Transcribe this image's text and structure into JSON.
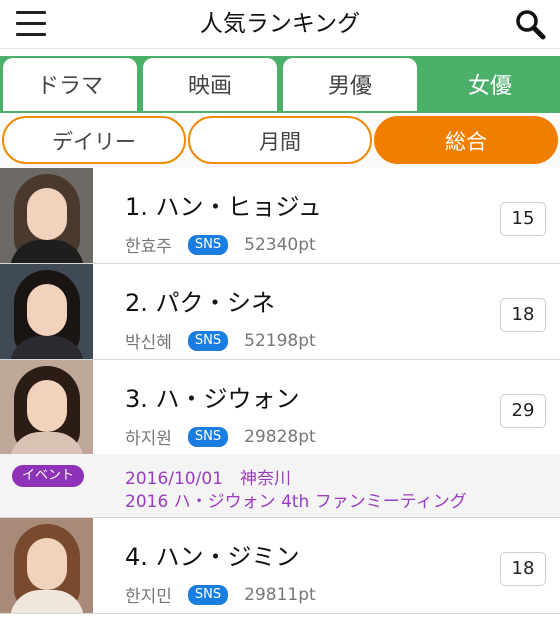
{
  "header": {
    "title": "人気ランキング",
    "menu_icon": "menu-icon",
    "search_icon": "search-icon"
  },
  "category_tabs": [
    {
      "label": "ドラマ",
      "active": false
    },
    {
      "label": "映画",
      "active": false
    },
    {
      "label": "男優",
      "active": false
    },
    {
      "label": "女優",
      "active": true
    }
  ],
  "period_tabs": [
    {
      "label": "デイリー",
      "active": false
    },
    {
      "label": "月間",
      "active": false
    },
    {
      "label": "総合",
      "active": true
    }
  ],
  "colors": {
    "green": "#4caf6a",
    "orange": "#f07f00",
    "sns_blue": "#1a7ee0",
    "event_purple": "#8e33b8"
  },
  "rankings": [
    {
      "name": "1. ハン・ヒョジュ",
      "korean": "한효주",
      "tag": "SNS",
      "points": "52340pt",
      "count": "15"
    },
    {
      "name": "2. パク・シネ",
      "korean": "박신혜",
      "tag": "SNS",
      "points": "52198pt",
      "count": "18"
    },
    {
      "name": "3. ハ・ジウォン",
      "korean": "하지원",
      "tag": "SNS",
      "points": "29828pt",
      "count": "29"
    },
    {
      "name": "4. ハン・ジミン",
      "korean": "한지민",
      "tag": "SNS",
      "points": "29811pt",
      "count": "18"
    }
  ],
  "event": {
    "badge": "イベント",
    "line1": "2016/10/01　神奈川",
    "line2": "2016 ハ・ジウォン 4th ファンミーティング"
  }
}
